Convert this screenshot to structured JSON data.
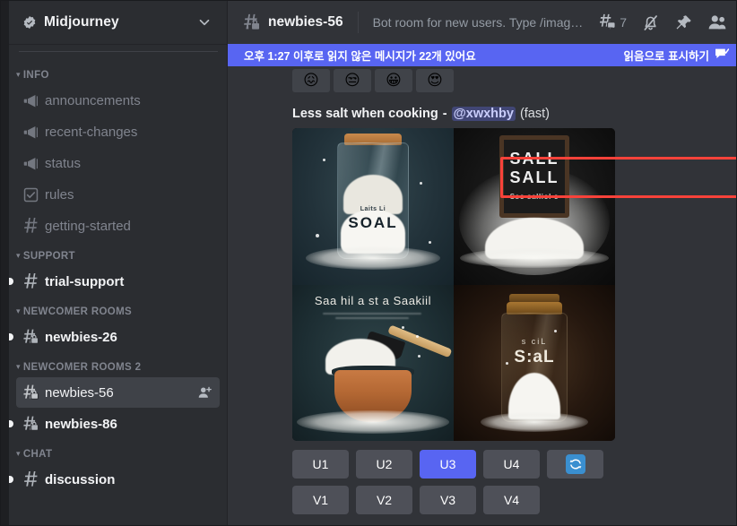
{
  "server": {
    "name": "Midjourney",
    "verified_badge": "verified-check-icon",
    "dropdown_icon": "chevron-down-icon"
  },
  "sidebar": {
    "categories": [
      {
        "label": "INFO",
        "channels": [
          {
            "label": "announcements",
            "icon": "announcement-megaphone-icon",
            "state": "read",
            "unread_pip": false
          },
          {
            "label": "recent-changes",
            "icon": "announcement-megaphone-icon",
            "state": "read",
            "unread_pip": false
          },
          {
            "label": "status",
            "icon": "announcement-megaphone-icon",
            "state": "read",
            "unread_pip": false
          },
          {
            "label": "rules",
            "icon": "rules-checkbox-icon",
            "state": "read",
            "unread_pip": false
          },
          {
            "label": "getting-started",
            "icon": "hash-icon",
            "state": "read",
            "unread_pip": false
          }
        ]
      },
      {
        "label": "SUPPORT",
        "channels": [
          {
            "label": "trial-support",
            "icon": "hash-icon",
            "state": "unread",
            "unread_pip": true
          }
        ]
      },
      {
        "label": "NEWCOMER ROOMS",
        "channels": [
          {
            "label": "newbies-26",
            "icon": "hash-lock-icon",
            "state": "unread",
            "unread_pip": true
          }
        ]
      },
      {
        "label": "NEWCOMER ROOMS 2",
        "channels": [
          {
            "label": "newbies-56",
            "icon": "hash-lock-icon",
            "state": "active",
            "unread_pip": false,
            "trailing_icon": "add-member-icon"
          },
          {
            "label": "newbies-86",
            "icon": "hash-lock-icon",
            "state": "unread",
            "unread_pip": true
          }
        ]
      },
      {
        "label": "CHAT",
        "channels": [
          {
            "label": "discussion",
            "icon": "hash-icon",
            "state": "unread",
            "unread_pip": true
          }
        ]
      }
    ]
  },
  "topbar": {
    "channel_icon": "hash-lock-icon",
    "channel_name": "newbies-56",
    "topic": "Bot room for new users. Type /imagine ...",
    "actions": [
      {
        "name": "threads-button",
        "icon": "threads-icon",
        "count": "7"
      },
      {
        "name": "notification-mute-button",
        "icon": "bell-muted-icon",
        "count": ""
      },
      {
        "name": "pinned-messages-button",
        "icon": "pin-icon",
        "count": ""
      },
      {
        "name": "member-list-button",
        "icon": "members-icon",
        "count": ""
      }
    ]
  },
  "unread_bar": {
    "message": "오후 1:27 이후로 읽지 않은 메시지가 22개 있어요",
    "mark_read_label": "읽음으로 표시하기",
    "mark_read_icon": "mark-read-icon",
    "background": "#5865f2"
  },
  "message": {
    "reactions": [
      {
        "name": "reaction-confounded",
        "glyph": "😖"
      },
      {
        "name": "reaction-disappointed",
        "glyph": "😒"
      },
      {
        "name": "reaction-grinning",
        "glyph": "😀"
      },
      {
        "name": "reaction-heart-eyes",
        "glyph": "😍"
      }
    ],
    "prompt": {
      "text": "Less salt when cooking",
      "dash": "-",
      "mention": "@xwxhby",
      "suffix": "(fast)"
    },
    "highlight_color": "#f9423a",
    "images": [
      {
        "name": "grid-image-1",
        "alt_text": "SOAL",
        "sub_text": "Laits Li"
      },
      {
        "name": "grid-image-2",
        "alt_text": "SALL SALL",
        "sub_text": "Sso salIiol o"
      },
      {
        "name": "grid-image-3",
        "alt_text": "Saa hil a st a Saakiil",
        "sub_text": ""
      },
      {
        "name": "grid-image-4",
        "alt_text": "S:aL",
        "sub_text": "s ciL"
      }
    ],
    "upscale_buttons": [
      "U1",
      "U2",
      "U3",
      "U4"
    ],
    "variation_buttons": [
      "V1",
      "V2",
      "V3",
      "V4"
    ],
    "selected_button": "U3",
    "reroll_icon": "refresh-icon",
    "accent_color": "#5865f2"
  }
}
